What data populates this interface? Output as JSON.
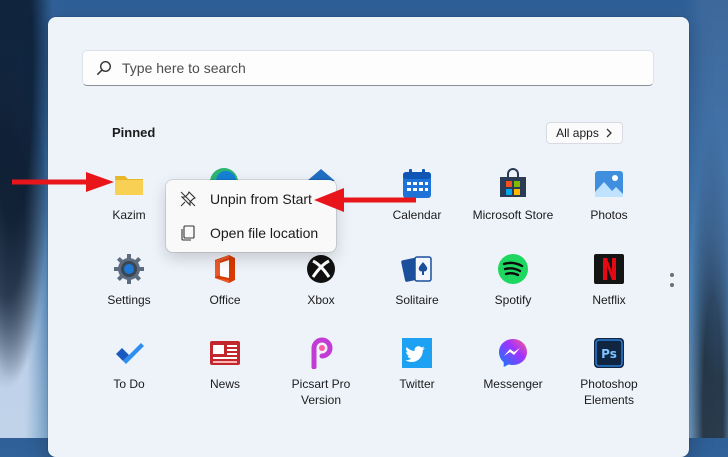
{
  "search": {
    "placeholder": "Type here to search"
  },
  "pinned": {
    "title": "Pinned",
    "all_apps_label": "All apps"
  },
  "apps": [
    {
      "label": "Kazim",
      "icon": "folder-icon"
    },
    {
      "label": "Calendar",
      "icon": "calendar-icon"
    },
    {
      "label": "Microsoft Store",
      "icon": "store-icon"
    },
    {
      "label": "Photos",
      "icon": "photos-icon"
    },
    {
      "label": "Settings",
      "icon": "settings-icon"
    },
    {
      "label": "Office",
      "icon": "office-icon"
    },
    {
      "label": "Xbox",
      "icon": "xbox-icon"
    },
    {
      "label": "Solitaire",
      "icon": "solitaire-icon"
    },
    {
      "label": "Spotify",
      "icon": "spotify-icon"
    },
    {
      "label": "Netflix",
      "icon": "netflix-icon"
    },
    {
      "label": "To Do",
      "icon": "todo-icon"
    },
    {
      "label": "News",
      "icon": "news-icon"
    },
    {
      "label": "Picsart Pro Version",
      "icon": "picsart-icon"
    },
    {
      "label": "Twitter",
      "icon": "twitter-icon"
    },
    {
      "label": "Messenger",
      "icon": "messenger-icon"
    },
    {
      "label": "Photoshop Elements",
      "icon": "photoshop-icon"
    }
  ],
  "context_menu": {
    "items": [
      {
        "label": "Unpin from Start",
        "icon": "unpin-icon"
      },
      {
        "label": "Open file location",
        "icon": "file-location-icon"
      }
    ]
  },
  "colors": {
    "accent_arrow": "#e8161b",
    "menu_bg": "#eef3fa"
  }
}
